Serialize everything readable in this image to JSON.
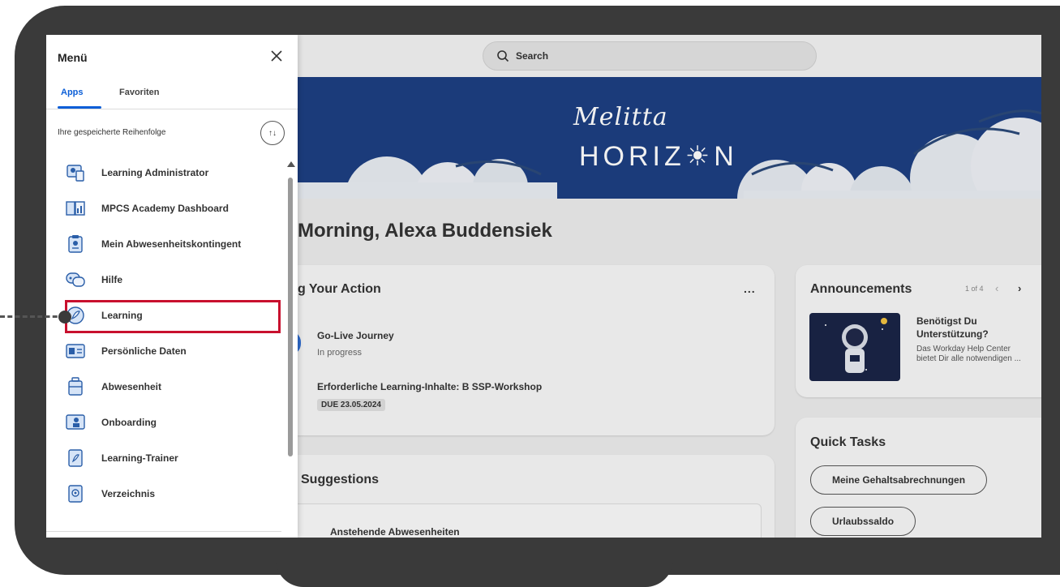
{
  "topbar": {
    "search_placeholder": "Search"
  },
  "banner": {
    "brand_script": "Melitta",
    "brand_word": "HORIZ☀N"
  },
  "greeting": "Morning, Alexa Buddensiek",
  "action_card": {
    "title": "g Your Action",
    "more": "...",
    "items": [
      {
        "title": "Go-Live Journey",
        "sub": "In progress"
      },
      {
        "title": "Erforderliche Learning-Inhalte: B SSP-Workshop",
        "due": "DUE 23.05.2024"
      }
    ]
  },
  "suggestions": {
    "title": "Suggestions",
    "item": "Anstehende Abwesenheiten"
  },
  "announcements": {
    "title": "Announcements",
    "page": "1 of 4",
    "headline": "Benötigst Du Unterstützung?",
    "body": "Das Workday Help Center bietet Dir alle notwendigen ..."
  },
  "quick_tasks": {
    "title": "Quick Tasks",
    "buttons": [
      "Meine Gehaltsabrechnungen",
      "Urlaubssaldo"
    ]
  },
  "menu": {
    "title": "Menü",
    "tabs": [
      "Apps",
      "Favoriten"
    ],
    "order_label": "Ihre gespeicherte Reihenfolge",
    "sort_glyph": "↑↓",
    "items": [
      {
        "label": "Learning Administrator",
        "icon": "learning-admin-icon"
      },
      {
        "label": "MPCS Academy Dashboard",
        "icon": "dashboard-icon"
      },
      {
        "label": "Mein Abwesenheitskontingent",
        "icon": "clipboard-icon"
      },
      {
        "label": "Hilfe",
        "icon": "help-icon"
      },
      {
        "label": "Learning",
        "icon": "learning-icon"
      },
      {
        "label": "Persönliche Daten",
        "icon": "id-card-icon"
      },
      {
        "label": "Abwesenheit",
        "icon": "suitcase-icon"
      },
      {
        "label": "Onboarding",
        "icon": "onboarding-icon"
      },
      {
        "label": "Learning-Trainer",
        "icon": "trainer-icon"
      },
      {
        "label": "Verzeichnis",
        "icon": "directory-icon"
      }
    ]
  },
  "colors": {
    "brand_blue": "#1d3f82",
    "accent": "#0b5ed7",
    "highlight": "#c8102e"
  }
}
